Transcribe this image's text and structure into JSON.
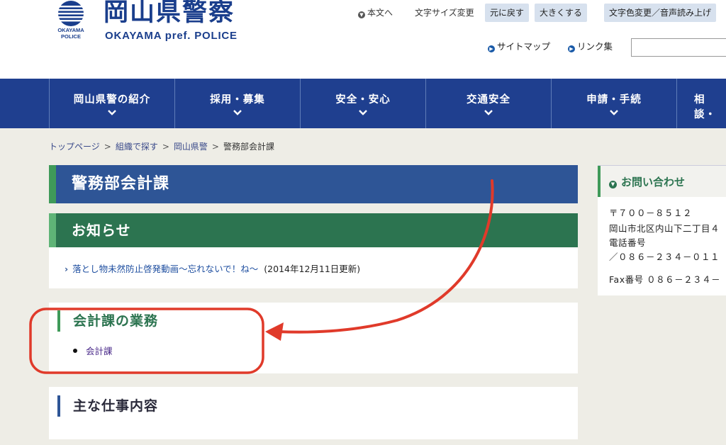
{
  "header": {
    "logo_title": "岡山県警察",
    "logo_en": "OKAYAMA pref. POLICE",
    "logo_sub_1": "OKAYAMA",
    "logo_sub_2": "POLICE",
    "skip_link": "本文へ",
    "font_size_label": "文字サイズ変更",
    "reset_button": "元に戻す",
    "enlarge_button": "大きくする",
    "color_voice_button": "文字色変更／音声読み上げ",
    "sitemap_link": "サイトマップ",
    "links_link": "リンク集"
  },
  "nav": {
    "items": [
      {
        "label": "岡山県警の紹介"
      },
      {
        "label": "採用・募集"
      },
      {
        "label": "安全・安心"
      },
      {
        "label": "交通安全"
      },
      {
        "label": "申請・手続"
      },
      {
        "label": "相談・"
      }
    ]
  },
  "breadcrumb": {
    "items": [
      "トップページ",
      "組織で探す",
      "岡山県警"
    ],
    "current": "警務部会計課"
  },
  "main": {
    "page_title": "警務部会計課",
    "news": {
      "heading": "お知らせ",
      "items": [
        {
          "title": "落とし物未然防止啓発動画～忘れないで！ね～",
          "date": "(2014年12月11日更新)"
        }
      ]
    },
    "duties": {
      "heading": "会計課の業務",
      "items": [
        "会計課"
      ]
    },
    "main_work": {
      "heading": "主な仕事内容"
    }
  },
  "sidebar": {
    "heading": "お問い合わせ",
    "postal": "〒７００－８５１２",
    "address": "岡山市北区内山下二丁目４",
    "phone_label": "電話番号",
    "phone": "／０８６－２３４－０１１",
    "fax": "Fax番号 ０８６－２３４－"
  },
  "colors": {
    "brand_blue": "#1f3f8f",
    "title_blue": "#2e5596",
    "green": "#2c7450",
    "accent_green": "#3f9a59",
    "annotation_red": "#e03a2a"
  }
}
